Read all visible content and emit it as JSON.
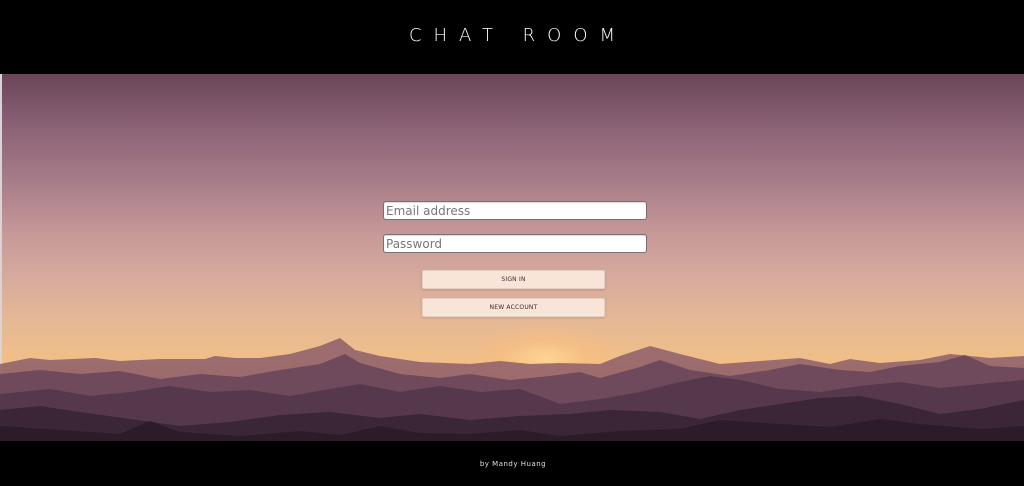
{
  "header": {
    "title": "CHAT ROOM"
  },
  "login": {
    "email_placeholder": "Email address",
    "password_placeholder": "Password",
    "signin_label": "SIGN IN",
    "new_account_label": "NEW ACCOUNT"
  },
  "footer": {
    "credit": "by Mandy Huang"
  },
  "colors": {
    "header_bg": "#000000",
    "button_bg": "#f9e4d8",
    "sky_top": "#6a4558",
    "sky_horizon": "#ea8a58"
  }
}
